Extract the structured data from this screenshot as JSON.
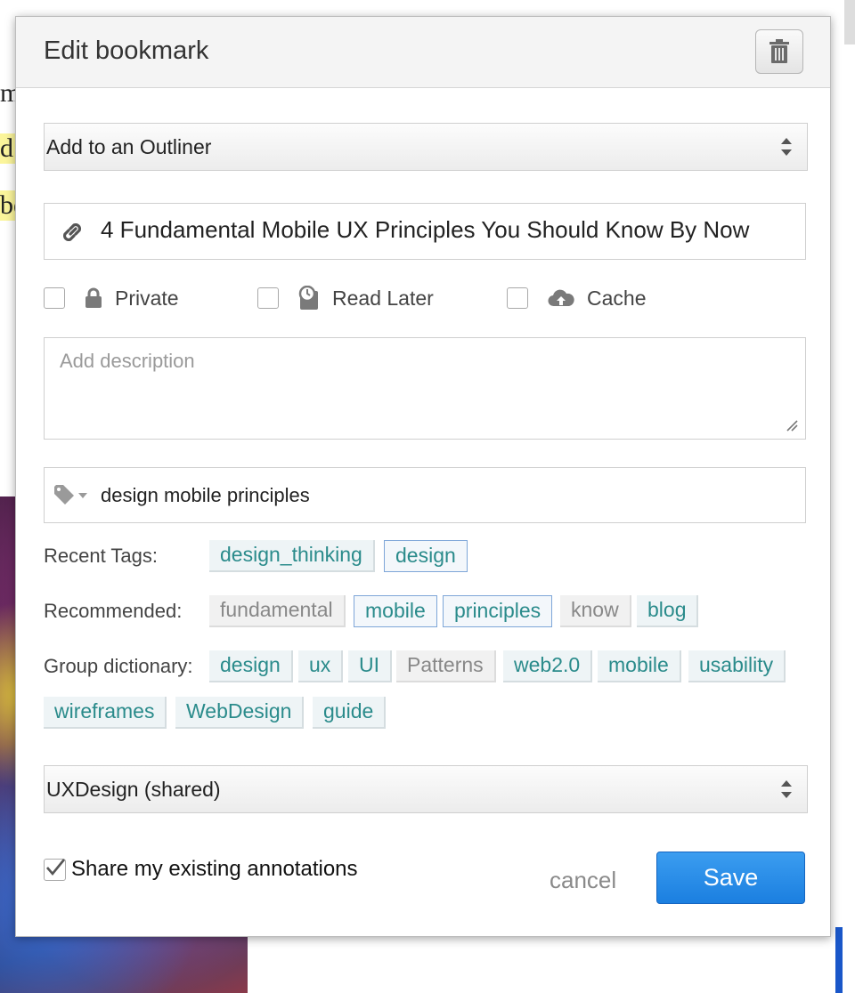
{
  "dialog": {
    "title": "Edit bookmark",
    "delete_icon": "trash-icon"
  },
  "outliner_select": {
    "value": "Add to an Outliner"
  },
  "bookmark_title": {
    "value": "4 Fundamental Mobile UX Principles You Should Know By Now",
    "icon": "link-icon"
  },
  "options": {
    "private": {
      "label": "Private",
      "icon": "lock-icon",
      "checked": false
    },
    "read_later": {
      "label": "Read Later",
      "icon": "clock-icon",
      "checked": false
    },
    "cache": {
      "label": "Cache",
      "icon": "cloud-upload-icon",
      "checked": false
    }
  },
  "description": {
    "placeholder": "Add description",
    "value": ""
  },
  "tags_input": {
    "value": "design mobile principles",
    "icon": "tag-icon"
  },
  "recent_tags": {
    "label": "Recent Tags:",
    "tags": [
      "design_thinking",
      "design"
    ]
  },
  "recommended": {
    "label": "Recommended:",
    "tags": [
      "fundamental",
      "mobile",
      "principles",
      "know",
      "blog"
    ]
  },
  "group_dictionary": {
    "label": "Group dictionary:",
    "tags": [
      "design",
      "ux",
      "UI",
      "Patterns",
      "web2.0",
      "mobile",
      "usability",
      "wireframes",
      "WebDesign",
      "guide"
    ]
  },
  "group_select": {
    "value": "UXDesign (shared)"
  },
  "share_annotations": {
    "label": "Share my existing annotations",
    "checked": true
  },
  "buttons": {
    "cancel": "cancel",
    "save": "Save"
  },
  "background": {
    "letters": [
      "m",
      "d",
      "be"
    ]
  },
  "colors": {
    "save_button": "#2088e6",
    "tag_text": "#2a8b8b",
    "highlight": "#fbf59b"
  }
}
